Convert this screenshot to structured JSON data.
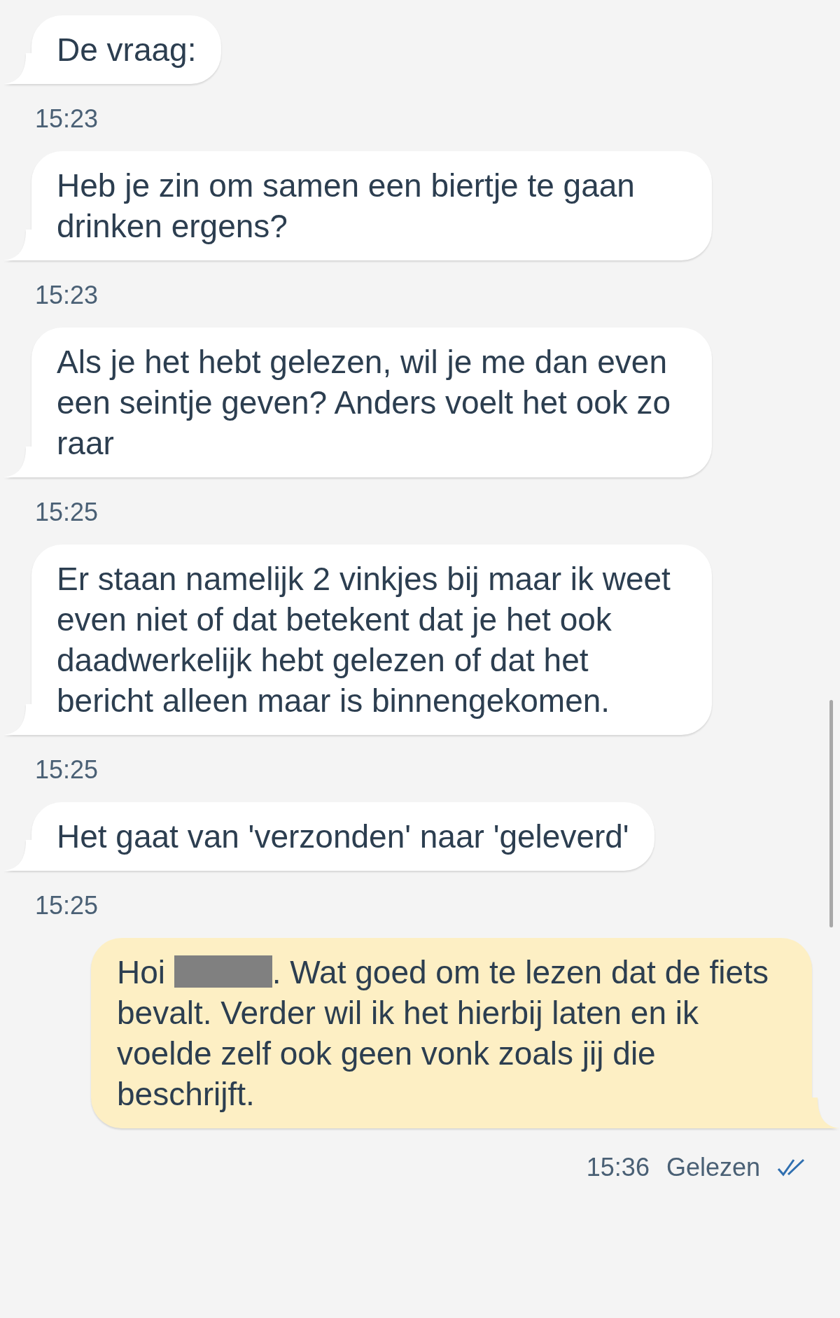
{
  "messages": [
    {
      "kind": "incoming",
      "segments": [
        {
          "kind": "text",
          "text": "De vraag:"
        }
      ],
      "time": "15:23"
    },
    {
      "kind": "incoming",
      "segments": [
        {
          "kind": "text",
          "text": "Heb je zin om samen een biertje te gaan drinken ergens?"
        }
      ],
      "time": "15:23"
    },
    {
      "kind": "incoming",
      "segments": [
        {
          "kind": "text",
          "text": "Als je het hebt gelezen, wil je me dan even een seintje geven? Anders voelt het ook zo raar"
        }
      ],
      "time": "15:25"
    },
    {
      "kind": "incoming",
      "segments": [
        {
          "kind": "text",
          "text": "Er staan namelijk 2 vinkjes bij maar ik weet even niet of dat betekent dat je het ook daadwerkelijk hebt gelezen of dat het bericht alleen maar is binnengekomen."
        }
      ],
      "time": "15:25"
    },
    {
      "kind": "incoming",
      "segments": [
        {
          "kind": "text",
          "text": "Het gaat van 'verzonden' naar 'geleverd'"
        }
      ],
      "time": "15:25"
    },
    {
      "kind": "outgoing",
      "segments": [
        {
          "kind": "text",
          "text": "Hoi "
        },
        {
          "kind": "redacted"
        },
        {
          "kind": "text",
          "text": ". Wat goed om te lezen dat de fiets bevalt. Verder wil ik het hierbij laten en ik voelde zelf ook geen vonk zoals jij die beschrijft."
        }
      ],
      "time": "15:36",
      "status": "Gelezen",
      "read": true
    }
  ]
}
